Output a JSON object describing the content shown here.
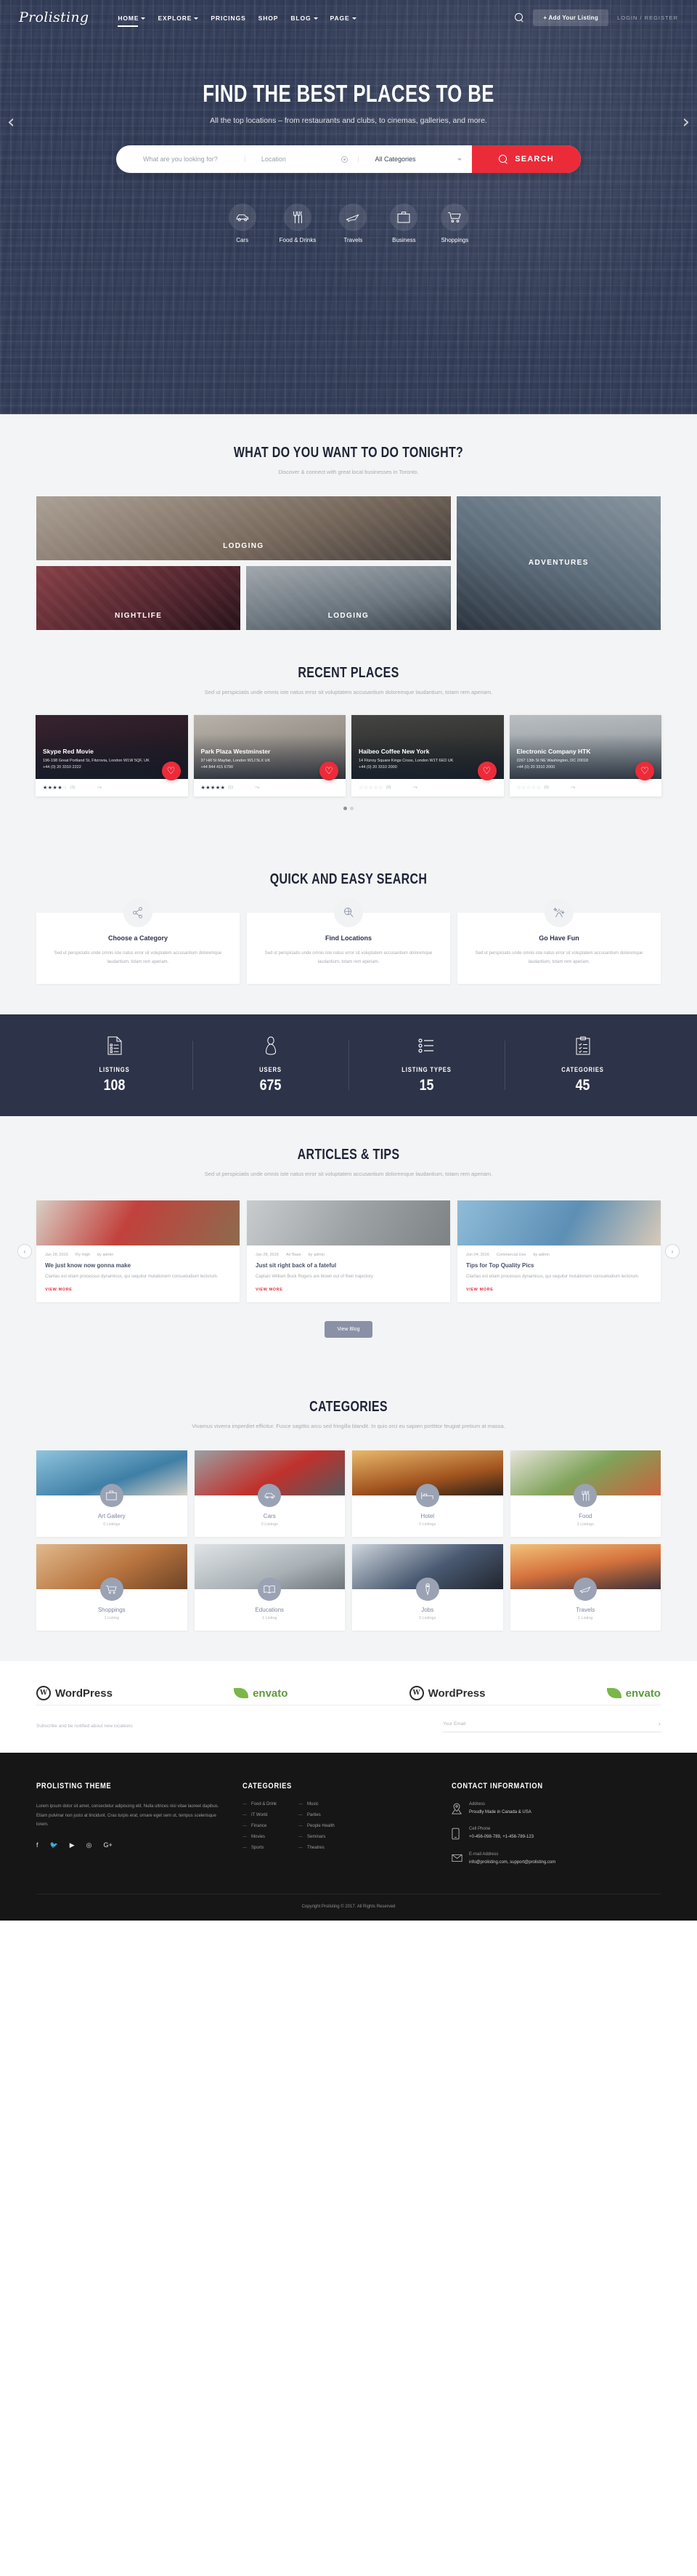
{
  "header": {
    "logo": "Prolisting",
    "nav": [
      {
        "label": "HOME",
        "caret": true,
        "active": true
      },
      {
        "label": "EXPLORE",
        "caret": true,
        "active": false
      },
      {
        "label": "PRICINGS",
        "caret": false,
        "active": false
      },
      {
        "label": "SHOP",
        "caret": false,
        "active": false
      },
      {
        "label": "BLOG",
        "caret": true,
        "active": false
      },
      {
        "label": "PAGE",
        "caret": true,
        "active": false
      }
    ],
    "search_icon": "search-icon",
    "add_listing": "+ Add Your Listing",
    "auth": "LOGIN / REGISTER"
  },
  "hero": {
    "prev_arrow": "‹",
    "next_arrow": "›",
    "title": "FIND THE BEST PLACES TO BE",
    "subtitle": "All the top locations – from restaurants and clubs, to cinemas, galleries, and more.",
    "search": {
      "keyword_placeholder": "What are you looking for?",
      "location_placeholder": "Location",
      "category_value": "All Categories",
      "button": "SEARCH"
    },
    "categories": [
      {
        "label": "Cars",
        "icon": "car-icon"
      },
      {
        "label": "Food & Drinks",
        "icon": "cutlery-icon"
      },
      {
        "label": "Travels",
        "icon": "plane-icon"
      },
      {
        "label": "Business",
        "icon": "briefcase-icon"
      },
      {
        "label": "Shoppings",
        "icon": "cart-icon"
      }
    ]
  },
  "tonight": {
    "title": "WHAT DO YOU WANT TO DO TONIGHT?",
    "subtitle": "Discover & connect with great local businesses in Toronto.",
    "tiles": [
      {
        "label": "LODGING"
      },
      {
        "label": "ADVENTURES"
      },
      {
        "label": "NIGHTLIFE"
      },
      {
        "label": "LODGING"
      }
    ]
  },
  "recent": {
    "title": "RECENT PLACES",
    "subtitle": "Sed ut perspiciatis unde omnis iste natus error sit voluptatem accusantium doloremque laudantium, totam rem aperiam.",
    "cards": [
      {
        "title": "Skype Red Movie",
        "address": "196-198 Great Portland St, Fitzrovia, London W1W 5QF, UK",
        "phone": "+44 (0) 20 3310 2222",
        "rating": 4,
        "reviews": "(1)"
      },
      {
        "title": "Park Plaza Westminster",
        "address": "37 Hill St Mayfair, London W1J 5LX UK",
        "phone": "+44 844 415 6790",
        "rating": 5,
        "reviews": "(1)"
      },
      {
        "title": "Haibeo Coffee New York",
        "address": "14 Fitzroy Square Kings Cross, London W1T 6ED UK",
        "phone": "+44 (0) 20 3310 2000",
        "rating": 0,
        "reviews": "(0)"
      },
      {
        "title": "Electronic Company HTK",
        "address": "2267 13th St NE Washington, DC 20018",
        "phone": "+44 (0) 20 3310 2000",
        "rating": 0,
        "reviews": "(0)"
      }
    ]
  },
  "quick": {
    "title": "QUICK AND EASY SEARCH",
    "cards": [
      {
        "title": "Choose a Category",
        "icon": "share-icon",
        "text": "Sed ut perspiciatis unde omnis iste natus error sit voluptatem accusantium doloremque laudantium, totam rem aperiam."
      },
      {
        "title": "Find Locations",
        "icon": "globe-search-icon",
        "text": "Sed ut perspiciatis unde omnis iste natus error sit voluptatem accusantium doloremque laudantium, totam rem aperiam."
      },
      {
        "title": "Go Have Fun",
        "icon": "fireworks-icon",
        "text": "Sed ut perspiciatis unde omnis iste natus error sit voluptatem accusantium doloremque laudantium, totam rem aperiam."
      }
    ]
  },
  "stats": [
    {
      "label": "LISTINGS",
      "value": "108",
      "icon": "document-list-icon"
    },
    {
      "label": "USERS",
      "value": "675",
      "icon": "user-icon"
    },
    {
      "label": "LISTING TYPES",
      "value": "15",
      "icon": "bullet-list-icon"
    },
    {
      "label": "CATEGORIES",
      "value": "45",
      "icon": "clipboard-check-icon"
    }
  ],
  "articles": {
    "title": "ARTICLES & TIPS",
    "subtitle": "Sed ut perspiciatis unde omnis iste natus error sit voluptatem accusantium doloremque laudantium, totam rem aperiam.",
    "prev_arrow": "‹",
    "next_arrow": "›",
    "view_blog": "View Blog",
    "read_more": "VIEW MORE",
    "items": [
      {
        "date": "Jan 28, 2016",
        "category": "Fly High",
        "author": "by admin",
        "title": "We just know now gonna make",
        "excerpt": "Claritas est etiam processus dynamicus, qui sequitur mutationem consuetudium lectorum."
      },
      {
        "date": "Jan 28, 2016",
        "category": "Air Base",
        "author": "by admin",
        "title": "Just sit right back of a fateful",
        "excerpt": "Captain William Buck Rogers are blown out of their trajectory"
      },
      {
        "date": "Jun 04, 2016",
        "category": "Commercial Use",
        "author": "by admin",
        "title": "Tips for Top Quality Pics",
        "excerpt": "Claritas est etiam processus dynamicus, qui sequitur mutationem consuetudium lectorum."
      }
    ]
  },
  "categories_section": {
    "title": "CATEGORIES",
    "subtitle": "Vivamus viverra imperdiet efficitur. Fusce sagittis arcu sed fringilla blandit. In quis orci eu sapien porttitor feugiat pretium at massa.",
    "items": [
      {
        "name": "Art Gallery",
        "listings": "0 Listings",
        "icon": "briefcase-icon"
      },
      {
        "name": "Cars",
        "listings": "0 Listings",
        "icon": "car-icon"
      },
      {
        "name": "Hotel",
        "listings": "0 Listings",
        "icon": "bed-icon"
      },
      {
        "name": "Food",
        "listings": "3 Listings",
        "icon": "cutlery-icon"
      },
      {
        "name": "Shoppings",
        "listings": "1 Listing",
        "icon": "cart-icon"
      },
      {
        "name": "Educations",
        "listings": "1 Listing",
        "icon": "book-icon"
      },
      {
        "name": "Jobs",
        "listings": "0 Listings",
        "icon": "tie-icon"
      },
      {
        "name": "Travels",
        "listings": "1 Listing",
        "icon": "plane-icon"
      }
    ]
  },
  "brands": [
    {
      "name": "WordPress",
      "type": "wordpress"
    },
    {
      "name": "envato",
      "type": "envato"
    },
    {
      "name": "WordPress",
      "type": "wordpress"
    },
    {
      "name": "envato",
      "type": "envato"
    }
  ],
  "subscribe": {
    "text": "Subscribe and be notified about new locations",
    "placeholder": "Your Email",
    "arrow": "›"
  },
  "footer": {
    "about": {
      "heading": "PROLISTING THEME",
      "text": "Lorem ipsum dolor sit amet, consectetur adipiscing elit. Nulla ultrices nisi vitae laoreet dapibus. Etiam pulvinar non justo at tincidunt. Cras turpis erat, ornare eget sem ut, tempus scelerisque lorem.",
      "social": [
        "f",
        "🐦",
        "▶",
        "◎",
        "G+"
      ]
    },
    "categories": {
      "heading": "CATEGORIES",
      "col1": [
        "Food & Drink",
        "IT World",
        "Finance",
        "Movies",
        "Sports"
      ],
      "col2": [
        "Music",
        "Parties",
        "People Health",
        "Seminars",
        "Theatres"
      ]
    },
    "contact": {
      "heading": "CONTACT INFORMATION",
      "items": [
        {
          "icon": "location-pin-icon",
          "label": "Address",
          "value": "Proudly Made in Canada & USA"
        },
        {
          "icon": "mobile-phone-icon",
          "label": "Cell Phone",
          "value": "+0-456-098-789, +1-456-789-123"
        },
        {
          "icon": "envelope-icon",
          "label": "E-mail Address",
          "value": "info@prolisting.com, support@prolisting.com"
        }
      ]
    },
    "copyright": "Copyright Prolisting © 2017. All Rights Reserved"
  },
  "colors": {
    "accent": "#ec2b39",
    "dark": "#2d3348",
    "footer": "#161616"
  }
}
